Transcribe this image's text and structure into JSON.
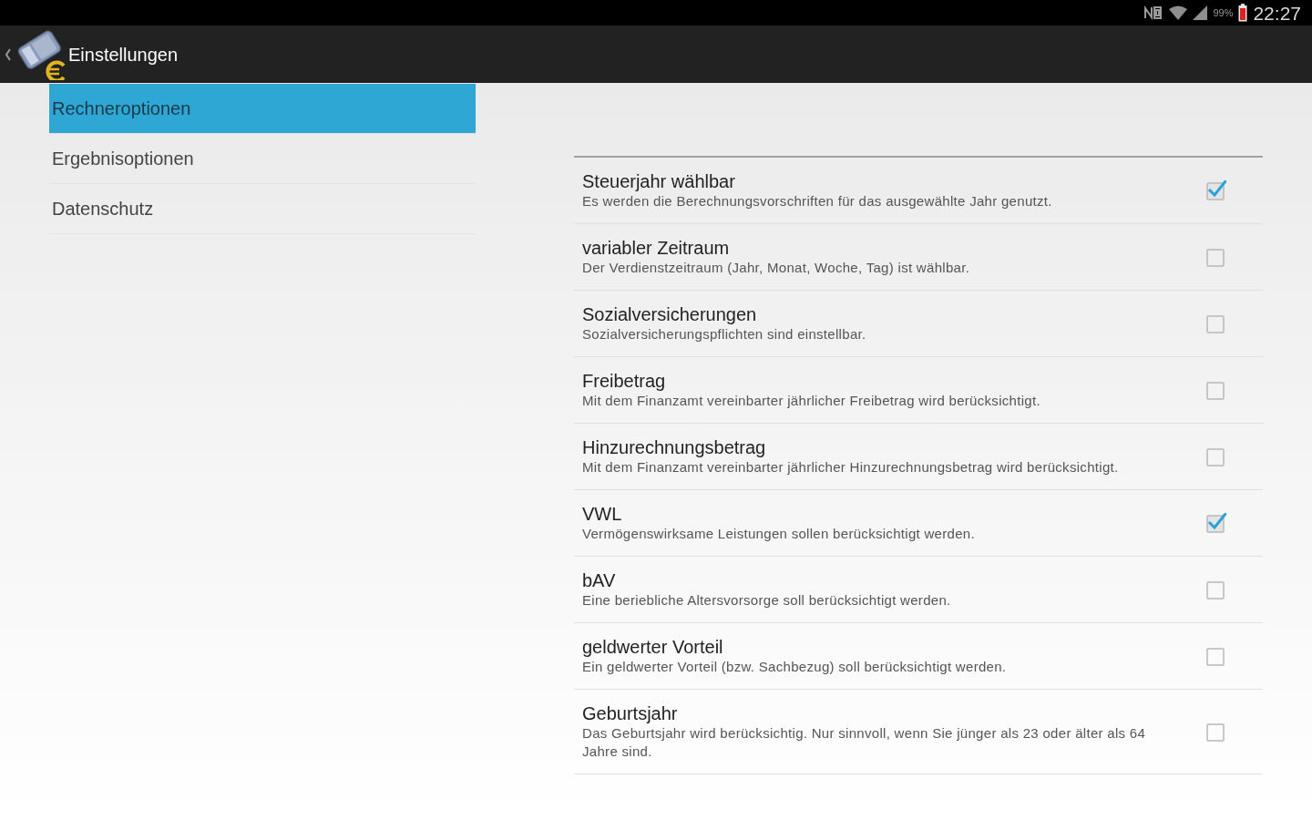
{
  "status_bar": {
    "battery_percent": "99%",
    "time": "22:27"
  },
  "action_bar": {
    "title": "Einstellungen"
  },
  "categories": [
    {
      "label": "Rechneroptionen",
      "selected": true
    },
    {
      "label": "Ergebnisoptionen",
      "selected": false
    },
    {
      "label": "Datenschutz",
      "selected": false
    }
  ],
  "settings": [
    {
      "title": "Steuerjahr wählbar",
      "summary": "Es werden die Berechnungsvorschriften für das ausgewählte Jahr genutzt.",
      "checked": true
    },
    {
      "title": "variabler Zeitraum",
      "summary": "Der Verdienstzeitraum (Jahr, Monat, Woche, Tag) ist wählbar.",
      "checked": false
    },
    {
      "title": "Sozialversicherungen",
      "summary": "Sozialversicherungspflichten sind einstellbar.",
      "checked": false
    },
    {
      "title": "Freibetrag",
      "summary": "Mit dem Finanzamt vereinbarter jährlicher Freibetrag wird berücksichtigt.",
      "checked": false
    },
    {
      "title": "Hinzurechnungsbetrag",
      "summary": "Mit dem Finanzamt vereinbarter jährlicher Hinzurechnungsbetrag wird berücksichtigt.",
      "checked": false
    },
    {
      "title": "VWL",
      "summary": "Vermögenswirksame Leistungen sollen berücksichtigt werden.",
      "checked": true
    },
    {
      "title": "bAV",
      "summary": "Eine beriebliche Altersvorsorge soll berücksichtigt werden.",
      "checked": false
    },
    {
      "title": "geldwerter Vorteil",
      "summary": "Ein geldwerter Vorteil (bzw. Sachbezug) soll berücksichtigt werden.",
      "checked": false
    },
    {
      "title": "Geburtsjahr",
      "summary": "Das Geburtsjahr wird berücksichtig. Nur sinnvoll, wenn Sie jünger als 23 oder älter als 64 Jahre sind.",
      "checked": false
    }
  ]
}
